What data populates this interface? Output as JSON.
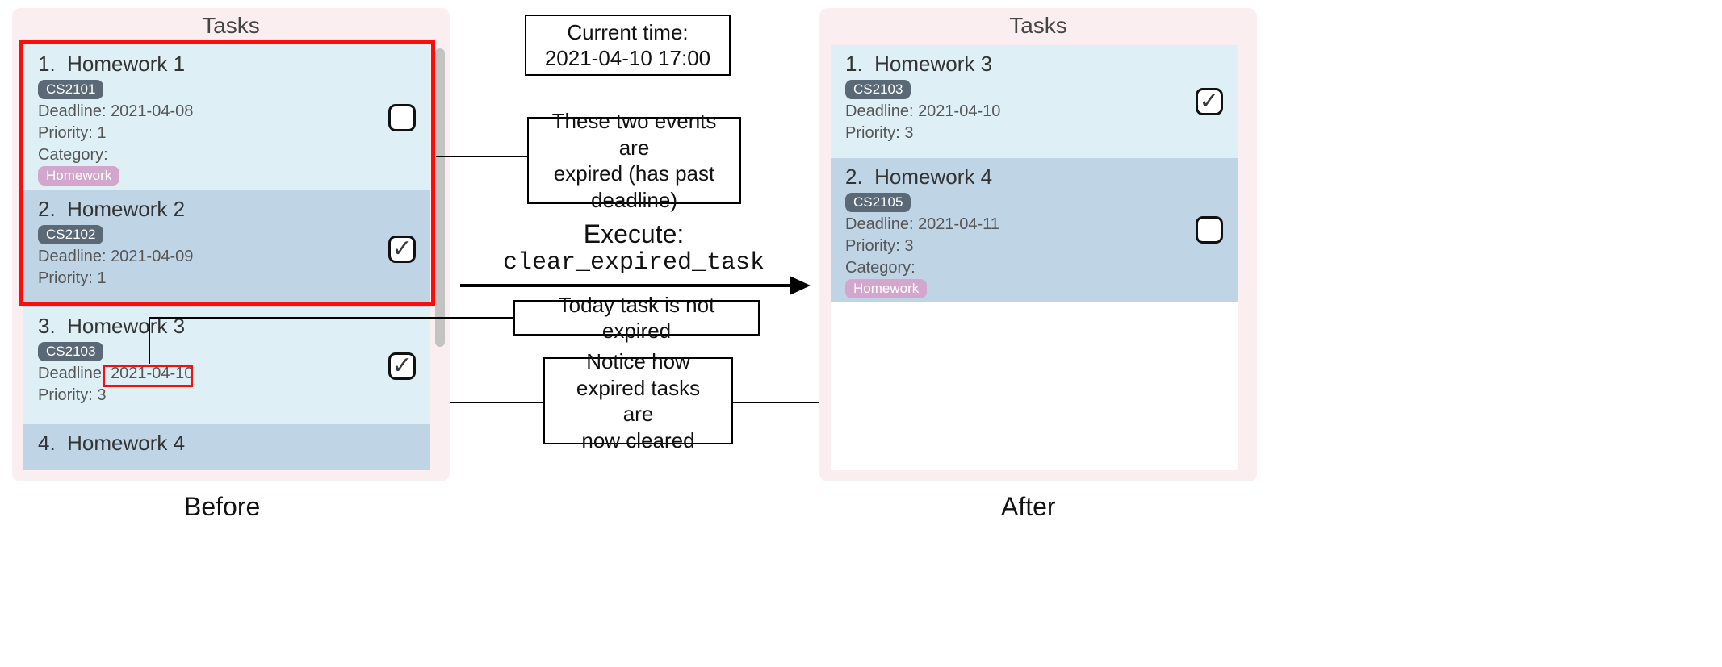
{
  "panels": {
    "title": "Tasks",
    "before_caption": "Before",
    "after_caption": "After"
  },
  "before": [
    {
      "idx": "1.",
      "name": "Homework 1",
      "code": "CS2101",
      "deadline_label": "Deadline: ",
      "deadline": "2021-04-08",
      "priority": "Priority: 1",
      "category_label": "Category:",
      "category": "Homework",
      "checked": false,
      "shade": "light"
    },
    {
      "idx": "2.",
      "name": "Homework 2",
      "code": "CS2102",
      "deadline_label": "Deadline: ",
      "deadline": "2021-04-09",
      "priority": "Priority: 1",
      "checked": true,
      "shade": "dark"
    },
    {
      "idx": "3.",
      "name": "Homework 3",
      "code": "CS2103",
      "deadline_label": "Deadline: ",
      "deadline": "2021-04-10",
      "priority": "Priority: 3",
      "checked": true,
      "shade": "light"
    },
    {
      "idx": "4.",
      "name": "Homework 4",
      "shade": "dark"
    }
  ],
  "after": [
    {
      "idx": "1.",
      "name": "Homework 3",
      "code": "CS2103",
      "deadline_label": "Deadline: ",
      "deadline": "2021-04-10",
      "priority": "Priority: 3",
      "checked": true,
      "shade": "light"
    },
    {
      "idx": "2.",
      "name": "Homework 4",
      "code": "CS2105",
      "deadline_label": "Deadline: ",
      "deadline": "2021-04-11",
      "priority": "Priority: 3",
      "category_label": "Category:",
      "category": "Homework",
      "checked": false,
      "shade": "dark"
    }
  ],
  "annotations": {
    "current_time_l1": "Current time:",
    "current_time_l2": "2021-04-10 17:00",
    "expired_l1": "These two events are",
    "expired_l2": "expired (has past",
    "expired_l3": "deadline)",
    "today": "Today task is not expired",
    "cleared_l1": "Notice how",
    "cleared_l2": "expired tasks are",
    "cleared_l3": "now cleared"
  },
  "execute": {
    "label": "Execute:",
    "command": "clear_expired_task"
  }
}
